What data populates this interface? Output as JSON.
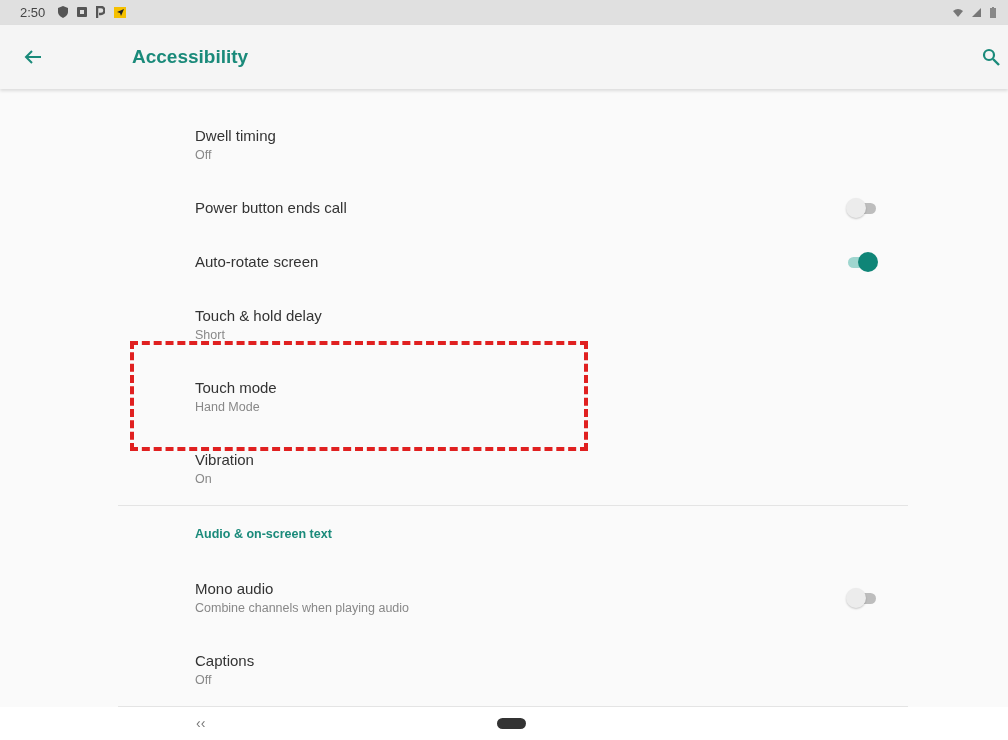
{
  "status_bar": {
    "time": "2:50"
  },
  "app_bar": {
    "title": "Accessibility"
  },
  "sections": [
    {
      "items": [
        {
          "kind": "text",
          "title": "Dwell timing",
          "summary": "Off"
        },
        {
          "kind": "switch",
          "title": "Power button ends call",
          "on": false
        },
        {
          "kind": "switch",
          "title": "Auto-rotate screen",
          "on": true
        },
        {
          "kind": "text",
          "title": "Touch & hold delay",
          "summary": "Short"
        },
        {
          "kind": "text",
          "title": "Touch mode",
          "summary": "Hand Mode",
          "highlighted": true
        },
        {
          "kind": "text",
          "title": "Vibration",
          "summary": "On"
        }
      ]
    },
    {
      "header": "Audio & on-screen text",
      "items": [
        {
          "kind": "switch",
          "title": "Mono audio",
          "summary": "Combine channels when playing audio",
          "on": false
        },
        {
          "kind": "text",
          "title": "Captions",
          "summary": "Off"
        }
      ]
    }
  ],
  "nav_bar": {
    "back": "‹‹"
  }
}
